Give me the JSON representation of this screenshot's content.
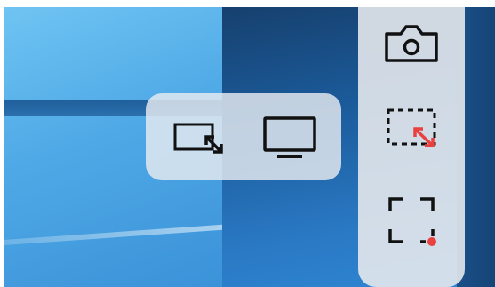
{
  "panel": {
    "mode_buttons": [
      {
        "name": "window-resize-mode",
        "icon": "window-resize-icon"
      },
      {
        "name": "monitor-mode",
        "icon": "monitor-icon"
      }
    ],
    "side_buttons": [
      {
        "name": "screenshot",
        "icon": "camera-icon"
      },
      {
        "name": "region-capture",
        "icon": "region-expand-icon"
      },
      {
        "name": "fullscreen-capture",
        "icon": "fullscreen-corners-icon"
      }
    ]
  },
  "colors": {
    "icon": "#111111",
    "accent": "#e8413f"
  }
}
